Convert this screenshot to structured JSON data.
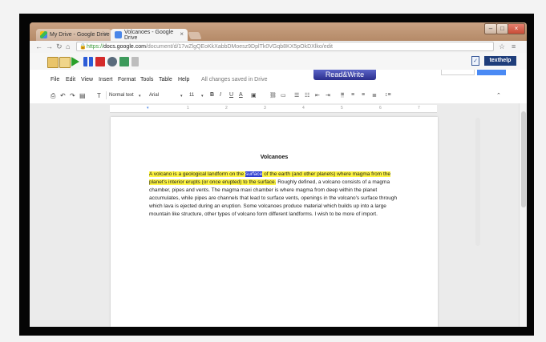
{
  "browser": {
    "tabs": [
      {
        "label": "My Drive - Google Drive",
        "active": false
      },
      {
        "label": "Volcanoes - Google Drive",
        "active": true
      }
    ],
    "address": {
      "scheme": "https://",
      "domain": "docs.google.com",
      "path": "/document/d/17wZlgQEoKkXabbDMoesz9DplTk0VGqb8KX5pOkDXlko/edit"
    },
    "nav_icons": [
      "back-icon",
      "forward-icon",
      "reload-icon",
      "home-icon"
    ],
    "controls": {
      "minimize": "–",
      "maximize": "□",
      "close": "×"
    }
  },
  "readwrite": {
    "brand": "texthelp",
    "tab_label": "Read&Write",
    "tool_icons": [
      "dictionary-icon",
      "picture-dictionary-icon",
      "play-icon",
      "pause-icon",
      "stop-icon",
      "screenshot-reader-icon",
      "translator-icon",
      "vocabulary-icon"
    ]
  },
  "docs": {
    "menu": [
      "File",
      "Edit",
      "View",
      "Insert",
      "Format",
      "Tools",
      "Table",
      "Help"
    ],
    "save_status": "All changes saved in Drive",
    "toolbar": {
      "style": "Normal text",
      "font": "Arial",
      "size": "11",
      "bold": "B",
      "italic": "I",
      "underline": "U",
      "text_color": "A"
    },
    "ruler_numbers": [
      "1",
      "2",
      "3",
      "4",
      "5",
      "6",
      "7"
    ],
    "document": {
      "title": "Volcanoes",
      "hl_before": "A volcano is a geological landform on the ",
      "selected_word": "surface",
      "hl_after": " of the earth (and other planets) where magma from the planet's interior erupts (or once erupted) to the surface.",
      "rest": " Roughly defined, a volcano consists of a magma chamber, pipes and vents. The magma maxi chamber is where magma from deep within the planet  accumulates, while pipes are channels that lead to surface vents, openings in the volcano's surface through which lava is ejected during an eruption. Some volcanoes produce material which builds up into a large mountain like structure, other types of volcano form different landforms. I wish to be more of import."
    }
  },
  "colors": {
    "chrome_frame": "#b98c6b",
    "highlight": "#fdf442",
    "selection": "#2b3bd1",
    "readwrite_tab": "#2a2e8c",
    "texthelp_brand": "#1e3d7a"
  }
}
